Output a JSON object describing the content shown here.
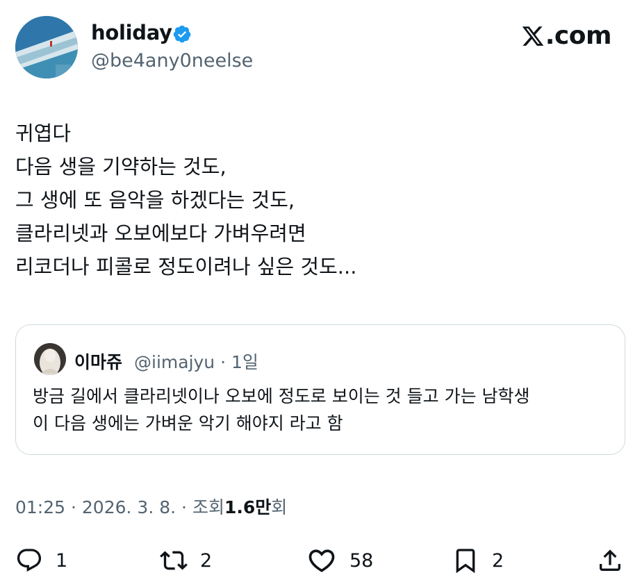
{
  "author": {
    "display_name": "holiday",
    "handle": "@be4any0neelse",
    "verified": true
  },
  "site": {
    "logo_text": ".com",
    "logo_icon": "x-logo-icon"
  },
  "tweet": {
    "text": "귀엽다\n다음 생을 기약하는 것도,\n그 생에 또 음악을 하겠다는 것도,\n클라리넷과 오보에보다 가벼우려면\n리코더나 피콜로 정도이려나 싶은 것도..."
  },
  "quote": {
    "display_name": "이마쥬",
    "handle": "@iimajyu",
    "separator": "·",
    "age": "1일",
    "text": "방금 길에서 클라리넷이나 오보에 정도로 보이는 것 들고 가는 남학생\n이 다음 생에는 가벼운 악기 해야지 라고 함"
  },
  "meta": {
    "time": "01:25",
    "date": "2026. 3. 8.",
    "separator": "·",
    "views_label_prefix": "조회",
    "views_value": "1.6만",
    "views_label_suffix": "회"
  },
  "actions": {
    "reply": {
      "icon": "reply-icon",
      "count": "1"
    },
    "repost": {
      "icon": "repost-icon",
      "count": "2"
    },
    "like": {
      "icon": "heart-icon",
      "count": "58"
    },
    "bookmark": {
      "icon": "bookmark-icon",
      "count": "2"
    },
    "share": {
      "icon": "share-icon"
    }
  },
  "colors": {
    "text": "#0f1419",
    "secondary": "#536471",
    "verified": "#1d9bf0",
    "border": "#cfd9de"
  }
}
